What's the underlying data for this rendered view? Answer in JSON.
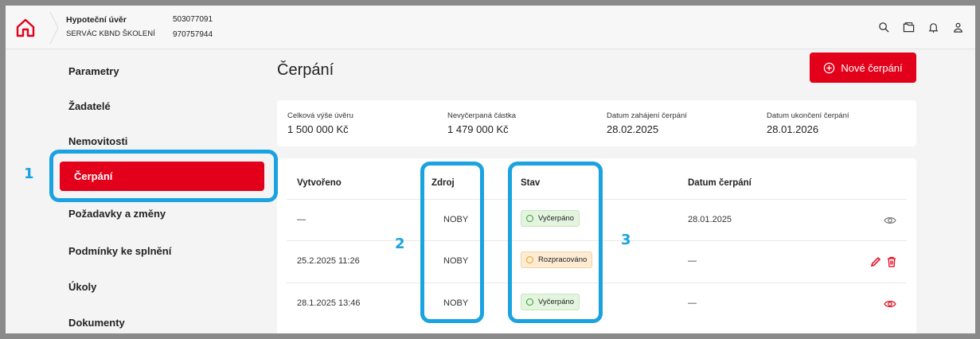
{
  "header": {
    "title": "Hypoteční úvěr",
    "title_number": "503077091",
    "subtitle": "SERVÁC KBND ŠKOLENÍ",
    "subtitle_number": "970757944",
    "icons": [
      "search-icon",
      "folder-icon",
      "bell-icon",
      "user-icon"
    ]
  },
  "sidebar": {
    "items": [
      {
        "label": "Parametry"
      },
      {
        "label": "Žadatelé"
      },
      {
        "label": "Nemovitosti"
      },
      {
        "label": "Čerpání",
        "active": true
      },
      {
        "label": "Požadavky a změny"
      },
      {
        "label": "Podmínky ke splnění"
      },
      {
        "label": "Úkoly"
      },
      {
        "label": "Dokumenty"
      }
    ]
  },
  "main": {
    "title": "Čerpání",
    "new_button": "Nové čerpání",
    "summary": [
      {
        "label": "Celková výše úvěru",
        "value": "1 500 000 Kč"
      },
      {
        "label": "Nevyčerpaná částka",
        "value": "1 479 000 Kč"
      },
      {
        "label": "Datum zahájení čerpání",
        "value": "28.02.2025"
      },
      {
        "label": "Datum ukončení čerpání",
        "value": "28.01.2026"
      }
    ],
    "table": {
      "columns": [
        "Vytvořeno",
        "Zdroj",
        "Stav",
        "Datum čerpání"
      ],
      "rows": [
        {
          "created": "—",
          "source": "NOBY",
          "status": "Vyčerpáno",
          "status_type": "green",
          "date": "28.01.2025",
          "actions": [
            "eye-icon"
          ]
        },
        {
          "created": "25.2.2025 11:26",
          "source": "NOBY",
          "status": "Rozpracováno",
          "status_type": "orange",
          "date": "—",
          "actions": [
            "pencil-icon",
            "trash-icon"
          ]
        },
        {
          "created": "28.1.2025 13:46",
          "source": "NOBY",
          "status": "Vyčerpáno",
          "status_type": "green",
          "date": "—",
          "actions": [
            "eye-icon"
          ]
        }
      ]
    }
  },
  "annotations": [
    "1",
    "2",
    "3"
  ],
  "colors": {
    "accent": "#e2001a",
    "highlight": "#1aa3e0",
    "status_green": "#3a9a33",
    "status_orange": "#e4a21d"
  }
}
